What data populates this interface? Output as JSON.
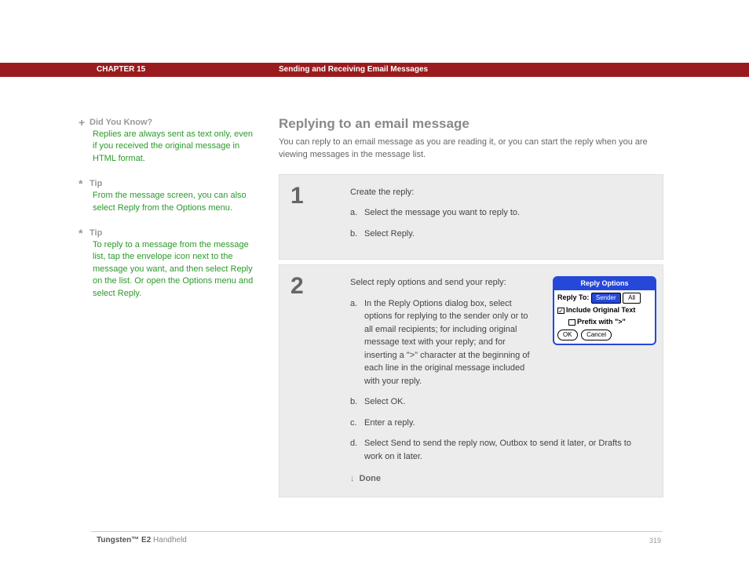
{
  "header": {
    "chapter": "CHAPTER 15",
    "title": "Sending and Receiving Email Messages"
  },
  "sidebar": {
    "tips": [
      {
        "icon": "+",
        "label": "Did You Know?",
        "body": "Replies are always sent as text only, even if you received the original message in HTML format."
      },
      {
        "icon": "*",
        "label": "Tip",
        "body": "From the message screen, you can also select Reply from the Options menu."
      },
      {
        "icon": "*",
        "label": "Tip",
        "body": "To reply to a message from the message list, tap the envelope icon next to the message you want, and then select Reply on the list. Or open the Options menu and select Reply."
      }
    ]
  },
  "main": {
    "title": "Replying to an email message",
    "intro": "You can reply to an email message as you are reading it, or you can start the reply when you are viewing messages in the message list.",
    "steps": [
      {
        "num": "1",
        "lead": "Create the reply:",
        "subs": [
          {
            "letter": "a.",
            "text": "Select the message you want to reply to."
          },
          {
            "letter": "b.",
            "text": "Select Reply."
          }
        ]
      },
      {
        "num": "2",
        "lead": "Select reply options and send your reply:",
        "subs": [
          {
            "letter": "a.",
            "text": "In the Reply Options dialog box, select options for replying to the sender only or to all email recipients; for including original message text with your reply; and for inserting a \">\" character at the beginning of each line in the original message included with your reply."
          },
          {
            "letter": "b.",
            "text": "Select OK."
          },
          {
            "letter": "c.",
            "text": "Enter a reply."
          },
          {
            "letter": "d.",
            "text": "Select Send to send the reply now, Outbox to send it later, or Drafts to work on it later."
          }
        ],
        "done": "Done"
      }
    ]
  },
  "dialog": {
    "title": "Reply Options",
    "reply_to_label": "Reply To:",
    "sender": "Sender",
    "all": "All",
    "include": "Include Original Text",
    "prefix": "Prefix with \">\"",
    "ok": "OK",
    "cancel": "Cancel"
  },
  "footer": {
    "product_bold": "Tungsten™ E2",
    "product_rest": " Handheld",
    "page": "319"
  }
}
